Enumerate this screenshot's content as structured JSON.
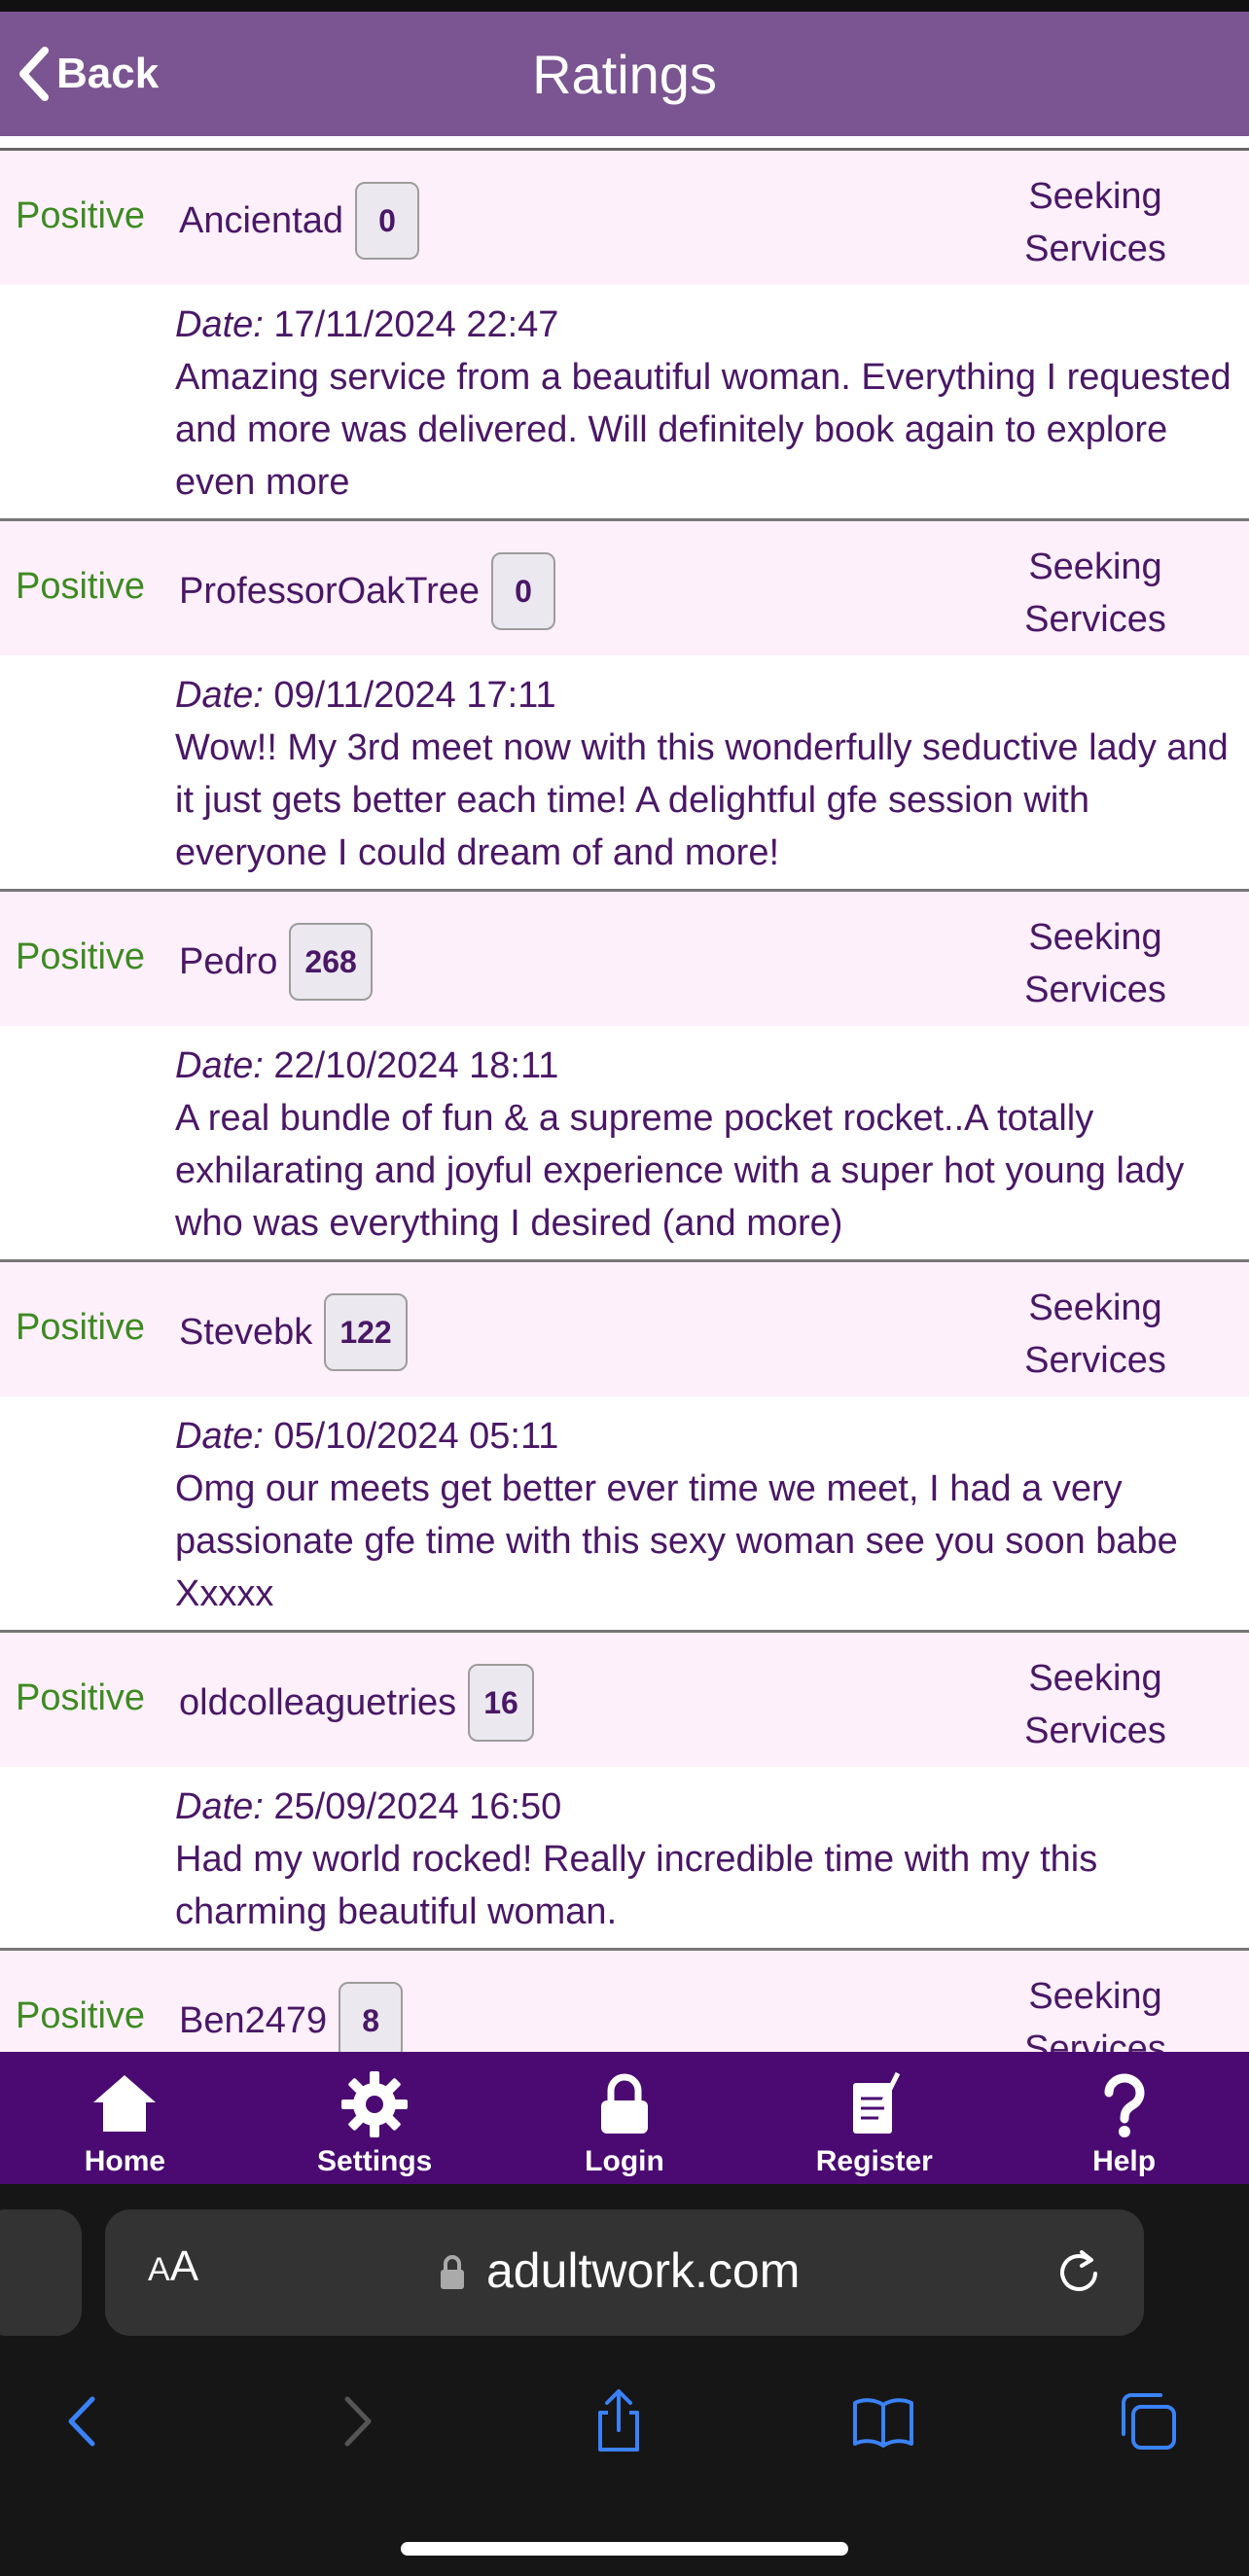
{
  "header": {
    "back_label": "Back",
    "title": "Ratings"
  },
  "ratings": [
    {
      "type": "Positive",
      "username": "Ancientad",
      "score": "0",
      "category_line1": "Seeking",
      "category_line2": "Services",
      "date_label": "Date:",
      "date": "17/11/2024 22:47",
      "text": "Amazing service from a beautiful woman. Everything I requested and more was delivered. Will definitely book again to explore even more"
    },
    {
      "type": "Positive",
      "username": "ProfessorOakTree",
      "score": "0",
      "category_line1": "Seeking",
      "category_line2": "Services",
      "date_label": "Date:",
      "date": "09/11/2024 17:11",
      "text": "Wow!! My 3rd meet now with this wonderfully seductive lady and it just gets better each time! A delightful gfe session with everyone I could dream of and more!"
    },
    {
      "type": "Positive",
      "username": "Pedro",
      "score": "268",
      "category_line1": "Seeking",
      "category_line2": "Services",
      "date_label": "Date:",
      "date": "22/10/2024 18:11",
      "text": "A real bundle of fun & a supreme pocket rocket..A totally exhilarating and joyful experience with a super hot young lady who was everything I desired (and more)"
    },
    {
      "type": "Positive",
      "username": "Stevebk",
      "score": "122",
      "category_line1": "Seeking",
      "category_line2": "Services",
      "date_label": "Date:",
      "date": "05/10/2024 05:11",
      "text": "Omg our meets get better ever time we meet, I had a very passionate gfe time with this sexy woman see you soon babe Xxxxx"
    },
    {
      "type": "Positive",
      "username": "oldcolleaguetries",
      "score": "16",
      "category_line1": "Seeking",
      "category_line2": "Services",
      "date_label": "Date:",
      "date": "25/09/2024 16:50",
      "text": "Had my world rocked! Really incredible time with my this charming beautiful woman."
    },
    {
      "type": "Positive",
      "username": "Ben2479",
      "score": "8",
      "category_line1": "Seeking",
      "category_line2": "Services"
    }
  ],
  "tabbar": {
    "home": "Home",
    "settings": "Settings",
    "login": "Login",
    "register": "Register",
    "help": "Help"
  },
  "browser": {
    "text_size_big": "A",
    "text_size_small": "A",
    "url": "adultwork.com"
  },
  "colors": {
    "header": "#7a5591",
    "tabbar": "#4a0a72",
    "positive": "#3e8a22",
    "text": "#4a1766",
    "row_bg": "#fdf0fa",
    "ios_blue": "#3a82f7"
  },
  "icons": [
    "chevron-left-icon",
    "home-icon",
    "gear-icon",
    "lock-icon",
    "register-icon",
    "help-icon",
    "reload-icon",
    "share-icon",
    "bookmarks-icon",
    "tabs-icon"
  ]
}
